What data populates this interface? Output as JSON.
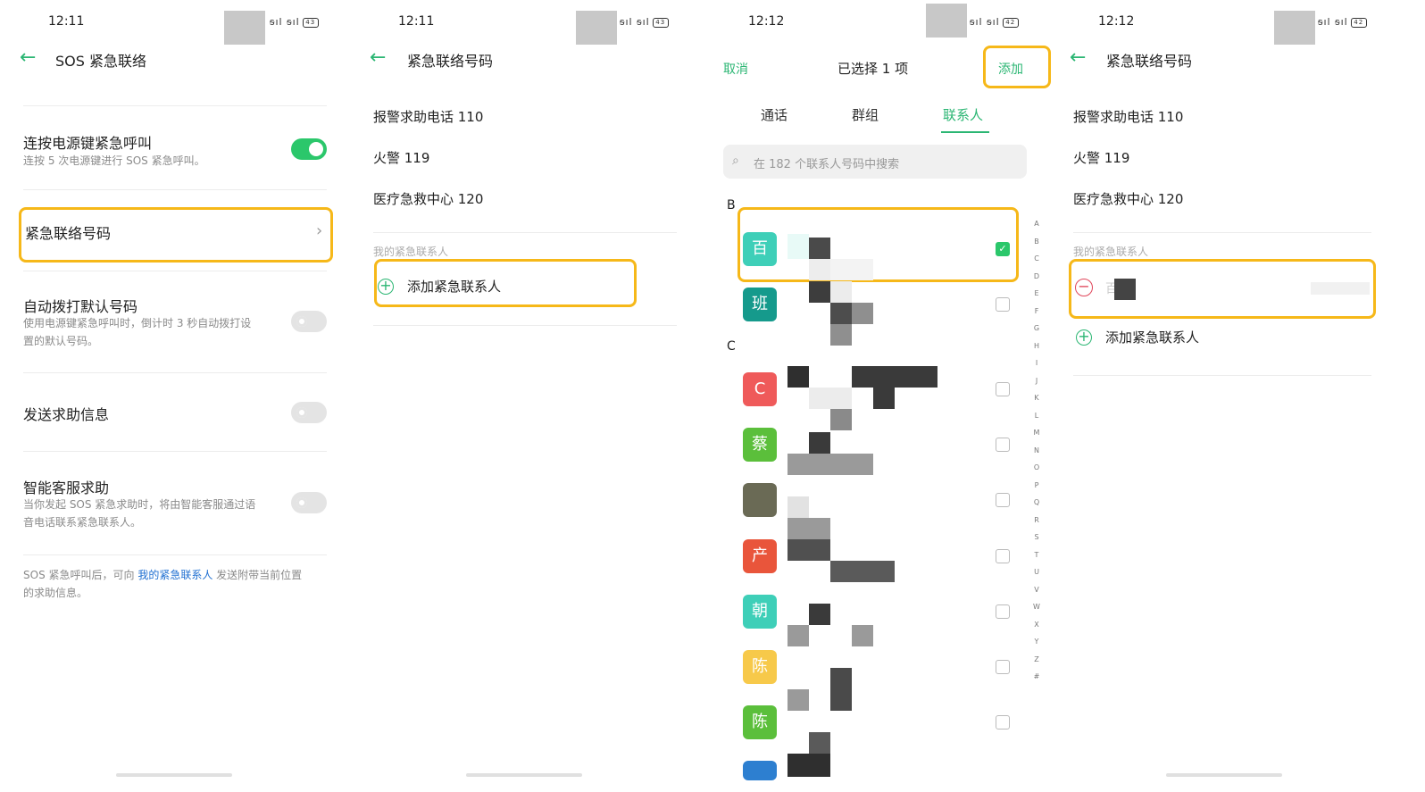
{
  "screen1": {
    "time": "12:11",
    "battery": "43",
    "title": "SOS 紧急联络",
    "power_sos": {
      "label": "连按电源键紧急呼叫",
      "desc": "连按 5 次电源键进行 SOS 紧急呼叫。",
      "enabled": true
    },
    "emergency_numbers": {
      "label": "紧急联络号码"
    },
    "auto_dial": {
      "label": "自动拨打默认号码",
      "desc1": "使用电源键紧急呼叫时，倒计时 3 秒自动拨打设",
      "desc2": "置的默认号码。",
      "enabled": false
    },
    "send_help": {
      "label": "发送求助信息",
      "enabled": false
    },
    "smart_service": {
      "label": "智能客服求助",
      "desc1": "当你发起 SOS 紧急求助时，将由智能客服通过语",
      "desc2": "音电话联系紧急联系人。",
      "enabled": false
    },
    "footer_pre": "SOS 紧急呼叫后，可向",
    "footer_link": "我的紧急联系人",
    "footer_post": "发送附带当前位置",
    "footer_line2": "的求助信息。"
  },
  "screen2": {
    "time": "12:11",
    "battery": "43",
    "title": "紧急联络号码",
    "numbers": [
      "报警求助电话 110",
      "火警 119",
      "医疗急救中心 120"
    ],
    "my_contacts_caption": "我的紧急联系人",
    "add_contact": "添加紧急联系人"
  },
  "screen3": {
    "time": "12:12",
    "battery": "42",
    "cancel": "取消",
    "selected": "已选择 1 项",
    "add": "添加",
    "tabs": [
      "通话",
      "群组",
      "联系人"
    ],
    "active_tab": 2,
    "search_placeholder": "在 182 个联系人号码中搜索",
    "sections": [
      {
        "letter": "B",
        "contacts": [
          {
            "avatar": "百",
            "color": "#3ecfb8",
            "checked": true
          },
          {
            "avatar": "班",
            "color": "#159a8c",
            "checked": false
          }
        ]
      },
      {
        "letter": "C",
        "contacts": [
          {
            "avatar": "C",
            "color": "#ef5a5a",
            "checked": false
          },
          {
            "avatar": "蔡",
            "color": "#5bbf3b",
            "checked": false
          },
          {
            "avatar": "",
            "color": "#6a6a55",
            "checked": false
          },
          {
            "avatar": "产",
            "color": "#e9553b",
            "checked": false
          },
          {
            "avatar": "朝",
            "color": "#3ecfb8",
            "checked": false
          },
          {
            "avatar": "陈",
            "color": "#f7c94a",
            "checked": false
          },
          {
            "avatar": "陈",
            "color": "#5bbf3b",
            "checked": false
          }
        ]
      }
    ],
    "index_letters": [
      "A",
      "B",
      "C",
      "D",
      "E",
      "F",
      "G",
      "H",
      "I",
      "J",
      "K",
      "L",
      "M",
      "N",
      "O",
      "P",
      "Q",
      "R",
      "S",
      "T",
      "U",
      "V",
      "W",
      "X",
      "Y",
      "Z",
      "#"
    ]
  },
  "screen4": {
    "time": "12:12",
    "battery": "42",
    "title": "紧急联络号码",
    "numbers": [
      "报警求助电话 110",
      "火警 119",
      "医疗急救中心 120"
    ],
    "my_contacts_caption": "我的紧急联系人",
    "contact_name": "百",
    "add_contact": "添加紧急联系人"
  },
  "colors": {
    "accent": "#2bb673",
    "highlight": "#f6b819",
    "remove": "#e0465a",
    "link": "#1f6fd1"
  },
  "icons": [
    "back-arrow-icon",
    "chevron-right-icon",
    "plus-circle-icon",
    "minus-circle-icon",
    "search-icon",
    "checkbox-icon",
    "signal-icon",
    "battery-icon"
  ]
}
